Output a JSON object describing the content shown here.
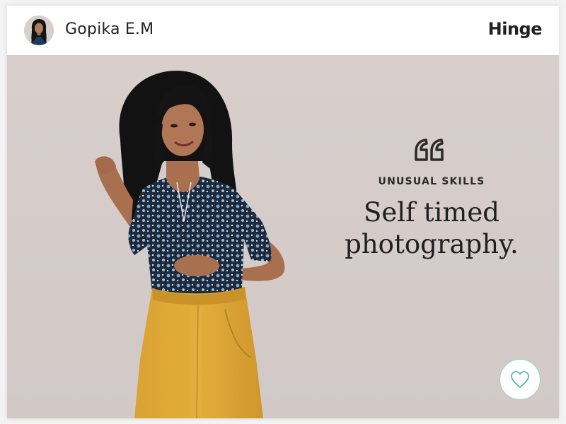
{
  "profile": {
    "name": "Gopika E.M",
    "avatar_icon": "profile-photo"
  },
  "brand": {
    "logo_text": "Hinge"
  },
  "prompt": {
    "icon": "quote-icon",
    "label": "UNUSUAL SKILLS",
    "answer": "Self timed\nphotography."
  },
  "actions": {
    "like_icon": "heart-icon",
    "like_border_color": "#8fd8c2"
  },
  "colors": {
    "background": "#f4f3f3",
    "card": "#ffffff",
    "photo_wall": "#d6cdcb",
    "text": "#222222"
  }
}
